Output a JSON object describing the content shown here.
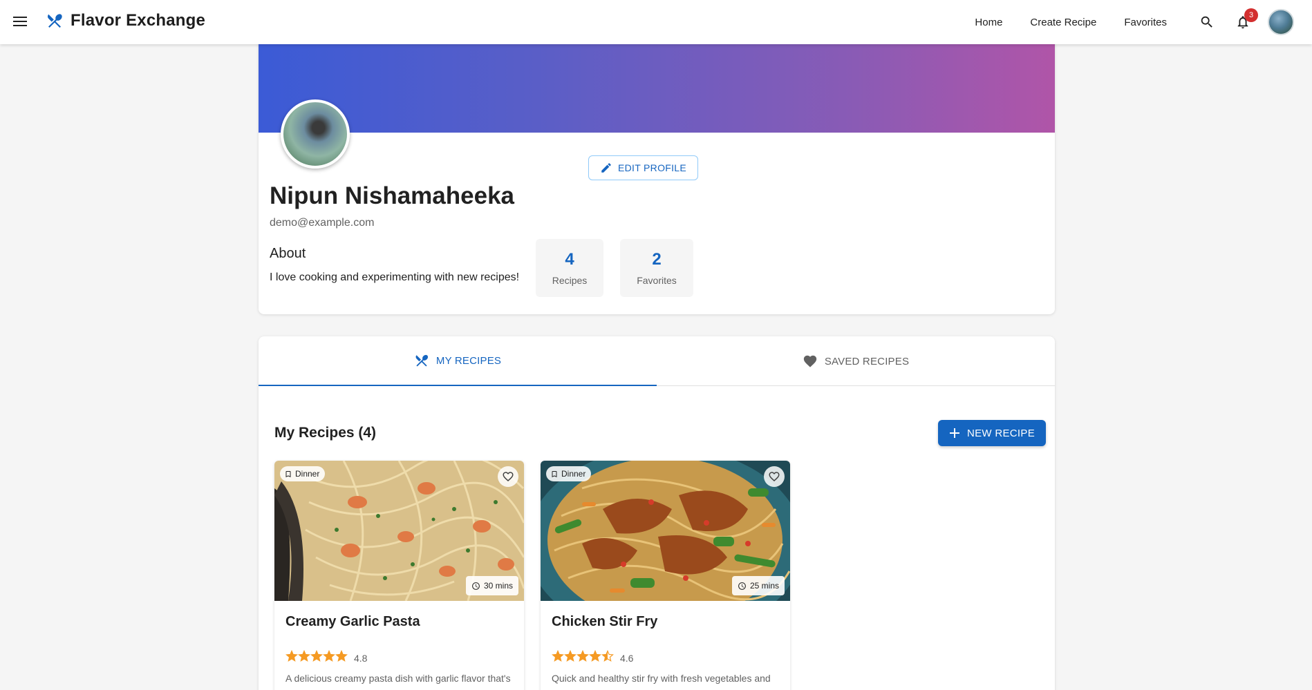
{
  "app": {
    "title": "Flavor Exchange"
  },
  "nav": {
    "links": [
      "Home",
      "Create Recipe",
      "Favorites"
    ],
    "notification_count": "3"
  },
  "profile": {
    "name": "Nipun Nishamaheeka",
    "email": "demo@example.com",
    "about_title": "About",
    "about_text": "I love cooking and experimenting with new recipes!",
    "edit_label": "EDIT PROFILE",
    "stats": [
      {
        "value": "4",
        "label": "Recipes"
      },
      {
        "value": "2",
        "label": "Favorites"
      }
    ]
  },
  "tabs": [
    {
      "label": "MY RECIPES",
      "icon": "utensils-icon",
      "active": true
    },
    {
      "label": "SAVED RECIPES",
      "icon": "heart-icon",
      "active": false
    }
  ],
  "recipes_section": {
    "title": "My Recipes (4)",
    "new_button": "NEW RECIPE"
  },
  "recipes": [
    {
      "category": "Dinner",
      "time": "30 mins",
      "title": "Creamy Garlic Pasta",
      "rating": 4.8,
      "rating_text": "4.8",
      "description": "A delicious creamy pasta dish with garlic flavor that's"
    },
    {
      "category": "Dinner",
      "time": "25 mins",
      "title": "Chicken Stir Fry",
      "rating": 4.6,
      "rating_text": "4.6",
      "description": "Quick and healthy stir fry with fresh vegetables and"
    }
  ],
  "colors": {
    "primary": "#1565c0",
    "star": "#f59a23",
    "badge": "#d32f2f",
    "banner_start": "#3b5bd6",
    "banner_end": "#b055a8"
  }
}
